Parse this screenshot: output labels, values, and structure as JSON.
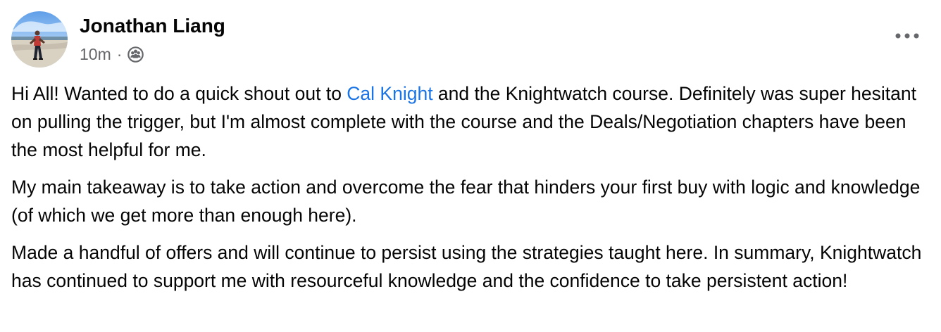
{
  "post": {
    "author": {
      "name": "Jonathan Liang",
      "avatar_icon": "profile-photo"
    },
    "timestamp": "10m",
    "separator": "·",
    "audience_icon": "group-audience-icon",
    "more_icon": "ellipsis-icon",
    "paragraphs": [
      {
        "before_mention": "Hi All! Wanted to do a quick shout out to ",
        "mention": "Cal Knight",
        "after_mention": " and the Knightwatch course. Definitely was super hesitant on pulling the trigger, but I'm almost complete with the course and the Deals/Negotiation chapters have been the most helpful for me."
      },
      {
        "text": "My main takeaway is to take action and overcome the fear that hinders your first buy with logic and knowledge (of which we get more than enough here)."
      },
      {
        "text": "Made a handful of offers and will continue to persist using the strategies taught here. In summary, Knightwatch has continued to support me with resourceful knowledge and the confidence to take persistent action!"
      }
    ]
  },
  "colors": {
    "text_primary": "#050505",
    "text_secondary": "#65676b",
    "mention": "#1b74e4"
  }
}
